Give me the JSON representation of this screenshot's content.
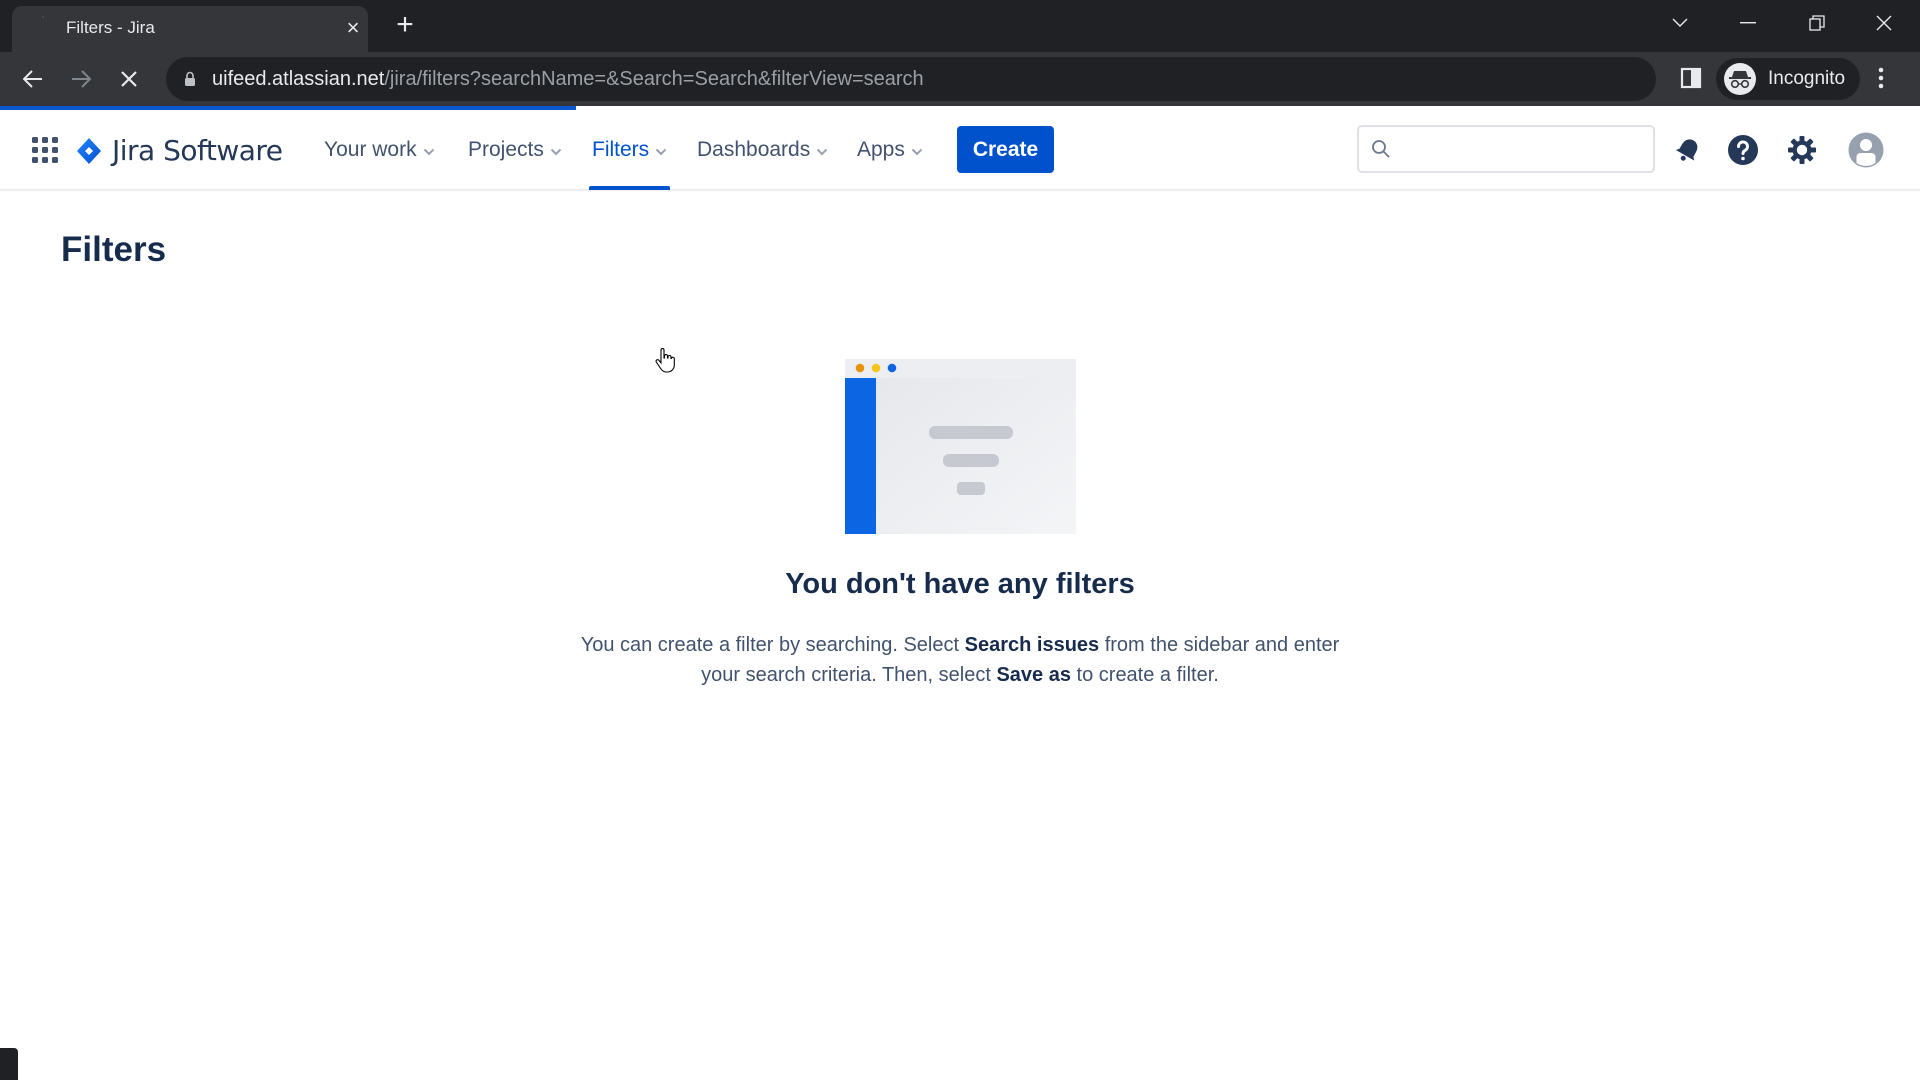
{
  "browser": {
    "tab_title": "Filters - Jira",
    "url_host": "uifeed.atlassian.net",
    "url_path": "/jira/filters?searchName=&Search=Search&filterView=search",
    "profile_label": "Incognito",
    "loading_progress_fraction": 0.3
  },
  "jira_nav": {
    "product_name": "Jira Software",
    "items": [
      {
        "label": "Your work",
        "active": false
      },
      {
        "label": "Projects",
        "active": false
      },
      {
        "label": "Filters",
        "active": true
      },
      {
        "label": "Dashboards",
        "active": false
      },
      {
        "label": "Apps",
        "active": false
      }
    ],
    "create_label": "Create",
    "search_placeholder": ""
  },
  "page": {
    "title": "Filters",
    "empty_state": {
      "title": "You don't have any filters",
      "desc_part1": "You can create a filter by searching. Select ",
      "desc_bold1": "Search issues",
      "desc_part2": " from the sidebar and enter your search criteria. Then, select ",
      "desc_bold2": "Save as",
      "desc_part3": " to create a filter."
    }
  },
  "colors": {
    "brand_blue": "#0052cc",
    "text_dark": "#172b4d",
    "text_body": "#42526e",
    "chrome_dark": "#202124",
    "chrome_toolbar": "#35363a",
    "loading_bar": "#0b57d0"
  }
}
